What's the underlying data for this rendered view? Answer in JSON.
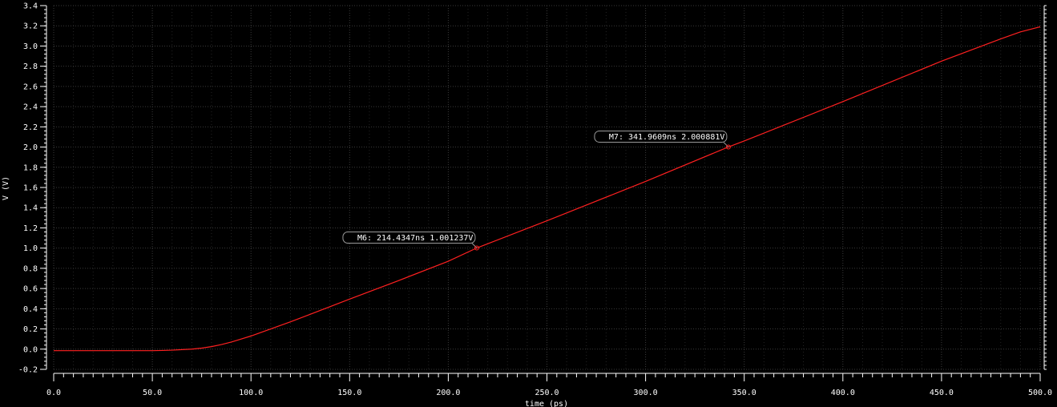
{
  "chart_data": {
    "type": "line",
    "xlabel": "time (ps)",
    "ylabel": "V (V)",
    "xlim": [
      0,
      500
    ],
    "ylim": [
      -0.2,
      3.4
    ],
    "x_ticks": [
      "0.0",
      "50.0",
      "100.0",
      "150.0",
      "200.0",
      "250.0",
      "300.0",
      "350.0",
      "400.0",
      "450.0",
      "500.0"
    ],
    "y_ticks": [
      "-0.2",
      "0.0",
      "0.2",
      "0.4",
      "0.6",
      "0.8",
      "1.0",
      "1.2",
      "1.4",
      "1.6",
      "1.8",
      "2.0",
      "2.2",
      "2.4",
      "2.6",
      "2.8",
      "3.0",
      "3.2",
      "3.4"
    ],
    "grid": true,
    "background": "#000000",
    "series": [
      {
        "color": "#ff2020",
        "x": [
          0,
          10,
          20,
          30,
          40,
          50,
          55,
          60,
          65,
          70,
          75,
          80,
          85,
          90,
          95,
          100,
          110,
          120,
          130,
          140,
          150,
          175,
          200,
          214.4347,
          250,
          300,
          341.9609,
          350,
          400,
          450,
          480,
          490,
          500
        ],
        "y": [
          -0.015,
          -0.015,
          -0.015,
          -0.015,
          -0.015,
          -0.015,
          -0.013,
          -0.01,
          -0.005,
          0.0,
          0.01,
          0.025,
          0.045,
          0.07,
          0.1,
          0.13,
          0.2,
          0.27,
          0.345,
          0.42,
          0.495,
          0.68,
          0.87,
          1.001237,
          1.27,
          1.66,
          2.000881,
          2.06,
          2.45,
          2.85,
          3.07,
          3.14,
          3.19
        ]
      }
    ],
    "markers": [
      {
        "label": "M6: 214.4347ns 1.001237V",
        "x": 214.4347,
        "y": 1.001237
      },
      {
        "label": "M7: 341.9609ns 2.000881V",
        "x": 341.9609,
        "y": 2.000881
      }
    ]
  }
}
